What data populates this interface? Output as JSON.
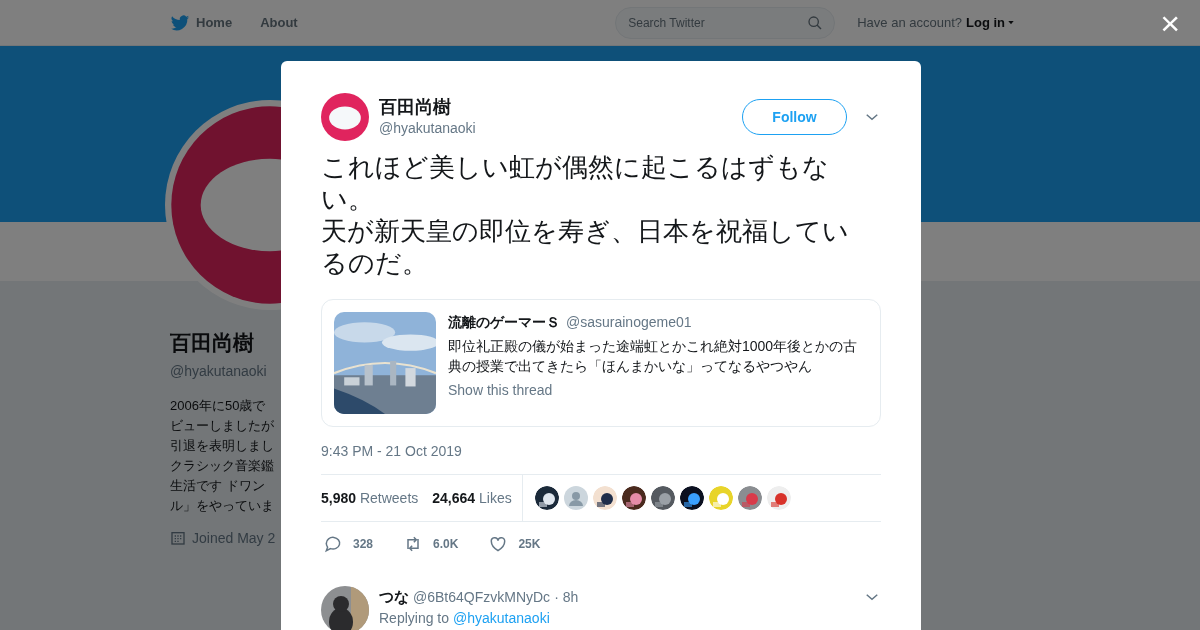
{
  "nav": {
    "home": "Home",
    "about": "About",
    "search_placeholder": "Search Twitter",
    "account_prompt": "Have an account?",
    "login": "Log in",
    "close": "×"
  },
  "profile": {
    "name": "百田尚樹",
    "handle": "@hyakutanaoki",
    "bio_lines": [
      "2006年に50歳で",
      "ビューしましたが",
      "引退を表明しまし",
      "クラシック音楽鑑",
      "生活です ドワン",
      "ル」をやっていま"
    ],
    "joined": "Joined May 2"
  },
  "tweet": {
    "name": "百田尚樹",
    "handle": "@hyakutanaoki",
    "follow": "Follow",
    "text_lines": [
      "これほど美しい虹が偶然に起こるはずもない。",
      "天が新天皇の即位を寿ぎ、日本を祝福しているのだ。"
    ],
    "quote": {
      "name": "流離のゲーマーＳ",
      "handle": "@sasurainogeme01",
      "text": "即位礼正殿の儀が始まった途端虹とかこれ絶対1000年後とかの古典の授業で出てきたら「ほんまかいな」ってなるやつやん",
      "thread_link": "Show this thread"
    },
    "time": "9:43 PM - 21 Oct 2019",
    "stats": [
      {
        "count": "5,980",
        "label": "Retweets"
      },
      {
        "count": "24,664",
        "label": "Likes"
      }
    ],
    "liker_avatars": [
      {
        "kind": "picture"
      },
      {
        "kind": "default"
      },
      {
        "kind": "picture"
      },
      {
        "kind": "picture"
      },
      {
        "kind": "picture"
      },
      {
        "kind": "picture"
      },
      {
        "kind": "picture"
      },
      {
        "kind": "picture"
      },
      {
        "kind": "picture"
      }
    ],
    "actions": [
      {
        "kind": "reply",
        "count": "328"
      },
      {
        "kind": "retweet",
        "count": "6.0K"
      },
      {
        "kind": "like",
        "count": "25K"
      }
    ]
  },
  "reply": {
    "name": "つな",
    "handle": "@6Bt64QFzvkMNyDc",
    "time": "· 8h",
    "replying_prefix": "Replying to",
    "replying_handle": "@hyakutanaoki"
  }
}
